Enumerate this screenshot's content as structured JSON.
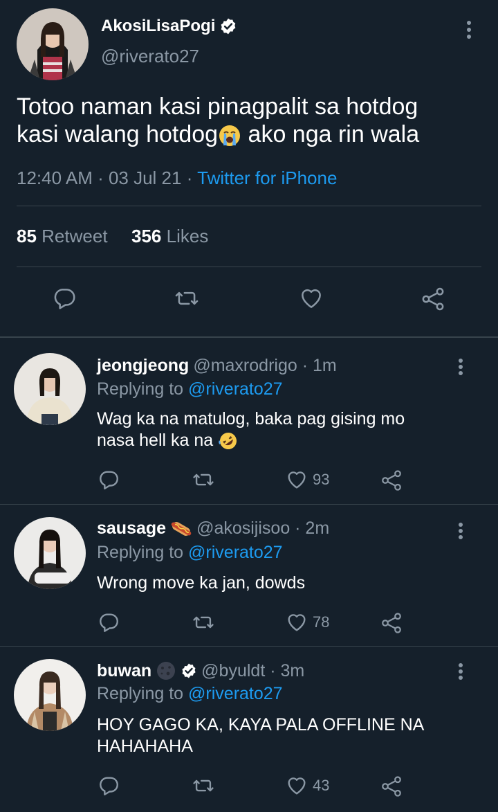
{
  "main_tweet": {
    "name": "AkosiLisaPogi",
    "handle": "@riverato27",
    "text_line1": "Totoo naman kasi pinagpalit sa hotdog",
    "text_line2": "kasi walang hotdog",
    "text_line2_after": " ako nga rin wala",
    "time": "12:40 AM · 03 Jul 21 · ",
    "source": "Twitter for iPhone",
    "retweets": "85",
    "retweets_label": "Retweet",
    "likes": "356",
    "likes_label": "Likes"
  },
  "replies": [
    {
      "name": "jeongjeong",
      "handle": "@maxrodrigo · 1m",
      "replying_label": "Replying to ",
      "replying_to": "@riverato27",
      "text_line1": "Wag ka na matulog, baka pag gising mo",
      "text_line2": "nasa hell ka na",
      "like_count": "93"
    },
    {
      "name": "sausage",
      "handle": "@akosijisoo · 2m",
      "replying_label": "Replying to ",
      "replying_to": "@riverato27",
      "text_line1": "Wrong move ka jan, dowds",
      "like_count": "78"
    },
    {
      "name": "buwan",
      "handle": "@byuldt · 3m",
      "replying_label": "Replying to ",
      "replying_to": "@riverato27",
      "text_line1": "HOY GAGO KA, KAYA PALA OFFLINE NA",
      "text_line2": "HAHAHAHA",
      "like_count": "43"
    }
  ],
  "colors": {
    "background": "#15202b",
    "text_secondary": "#8b98a5",
    "accent": "#1d9bf0",
    "divider": "#38444d"
  },
  "icons": [
    "verified-badge-icon",
    "more-options-icon",
    "reply-icon",
    "retweet-icon",
    "like-icon",
    "share-icon",
    "loudly-crying-face-emoji",
    "rolling-on-floor-laughing-emoji",
    "hotdog-emoji",
    "new-moon-face-emoji"
  ]
}
